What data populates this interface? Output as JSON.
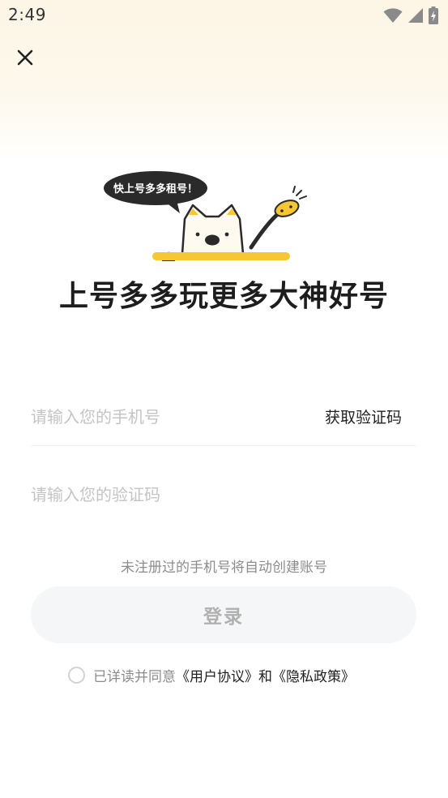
{
  "status_bar": {
    "time": "2:49",
    "icons": [
      "wifi-icon",
      "signal-icon",
      "battery-charging-icon"
    ]
  },
  "header": {
    "close_icon": "close-icon"
  },
  "banner": {
    "speech": "快上号多多租号！",
    "slogan": "上号多多玩更多大神好号"
  },
  "form": {
    "phone_placeholder": "请输入您的手机号",
    "phone_value": "",
    "get_code_label": "获取验证码",
    "code_placeholder": "请输入您的验证码",
    "code_value": ""
  },
  "hint": "未注册过的手机号将自动创建账号",
  "login_label": "登录",
  "agreement": {
    "prefix": "已详读并同意",
    "user_agreement": "《用户协议》",
    "and": "和",
    "privacy_policy": "《隐私政策》",
    "checked": false
  },
  "colors": {
    "accent_yellow": "#f7c733",
    "button_bg": "#f5f6f8",
    "placeholder": "#c4c4c4",
    "muted_text": "#8c8c8c"
  }
}
